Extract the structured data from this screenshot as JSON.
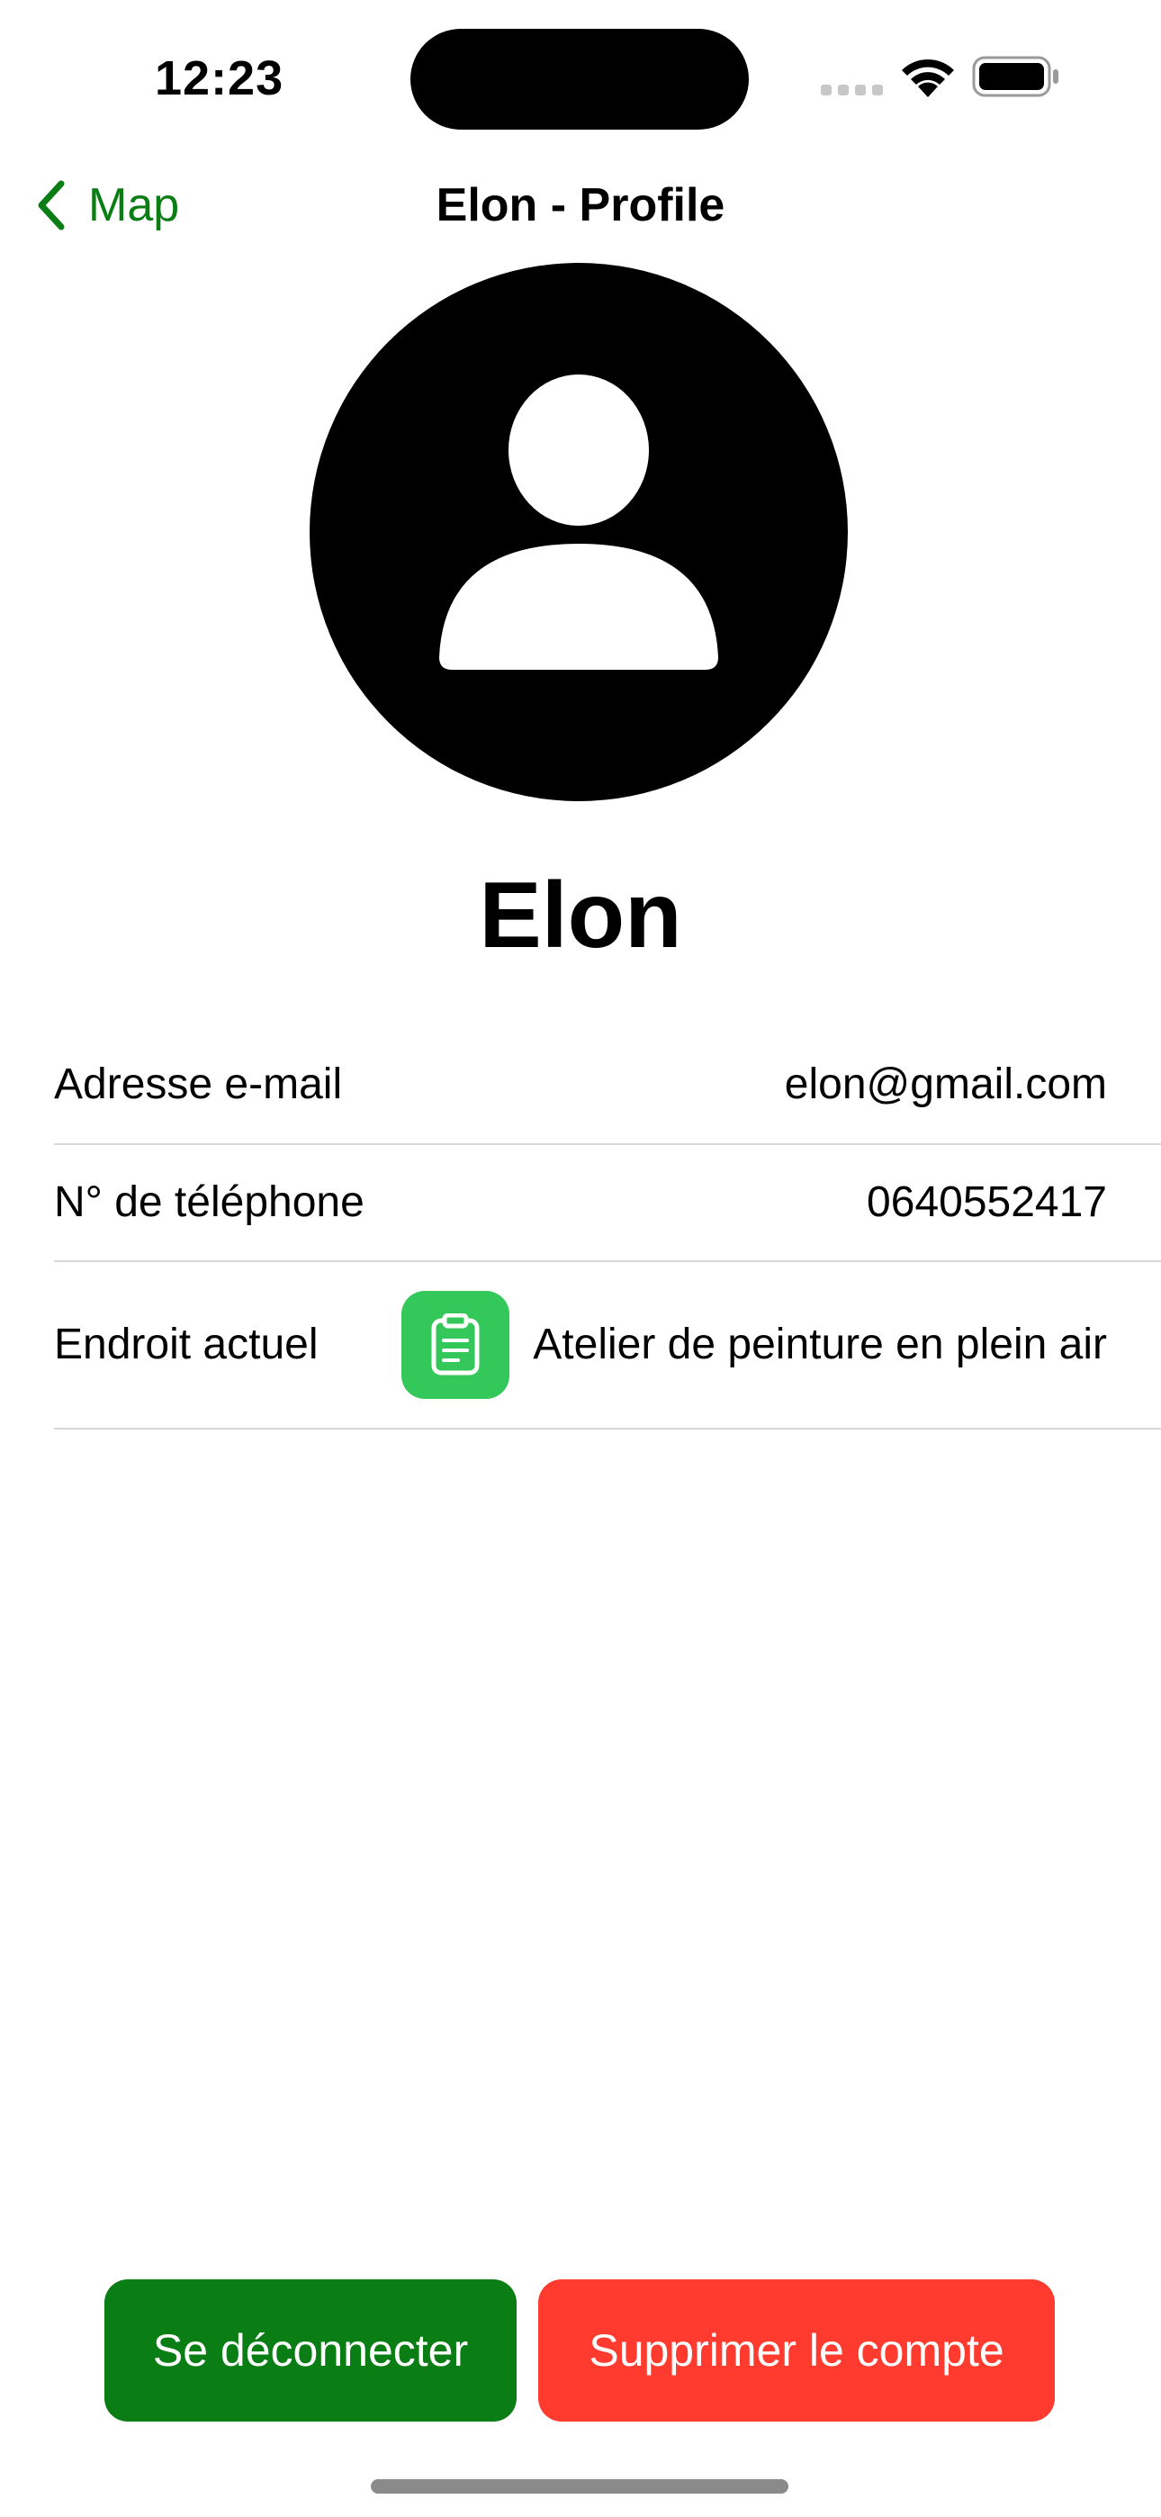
{
  "status_bar": {
    "time": "12:23"
  },
  "nav": {
    "back_label": "Map",
    "title": "Elon - Profile",
    "accent_color": "#0a7d14"
  },
  "profile": {
    "name": "Elon",
    "avatar_icon": "person-circle-icon"
  },
  "info_rows": [
    {
      "label": "Adresse e-mail",
      "value": "elon@gmail.com"
    },
    {
      "label": "N° de téléphone",
      "value": "0640552417"
    },
    {
      "label": "Endroit actuel",
      "value": "Atelier de peinture en plein air",
      "icon": "clipboard-icon",
      "icon_color": "#34c759"
    }
  ],
  "buttons": {
    "logout_label": "Se déconnecter",
    "logout_color": "#0a7d14",
    "delete_label": "Supprimer le compte",
    "delete_color": "#ff3b30"
  }
}
